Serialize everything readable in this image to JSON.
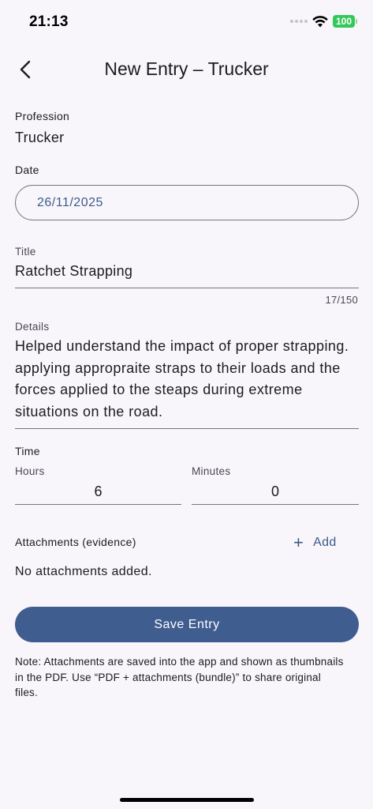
{
  "status_bar": {
    "time": "21:13",
    "battery": "100",
    "icons": [
      "signal-dots-icon",
      "wifi-icon",
      "battery-icon"
    ],
    "battery_color": "#34c759"
  },
  "header": {
    "back_icon": "chevron-left-icon",
    "title": "New Entry – Trucker"
  },
  "profession": {
    "label": "Profession",
    "value": "Trucker"
  },
  "date": {
    "label": "Date",
    "value": "26/11/2025"
  },
  "title_field": {
    "label": "Title",
    "value": "Ratchet Strapping",
    "counter": "17/150"
  },
  "details_field": {
    "label": "Details",
    "value": "Helped understand the impact of proper strapping. applying appropraite straps to their loads and the forces applied to the steaps during extreme situations on the road."
  },
  "time": {
    "label": "Time",
    "hours_label": "Hours",
    "hours_value": "6",
    "minutes_label": "Minutes",
    "minutes_value": "0"
  },
  "attachments": {
    "label": "Attachments (evidence)",
    "add_icon": "plus-icon",
    "add_label": "Add",
    "empty_text": "No attachments added."
  },
  "actions": {
    "save_label": "Save Entry"
  },
  "note": "Note: Attachments are saved into the app and shown as thumbnails in the PDF. Use “PDF + attachments (bundle)” to share original files.",
  "colors": {
    "accent": "#3f5d8f",
    "accent_text": "#3d5a8a",
    "background": "#f8f6fb",
    "outline": "#79747e"
  }
}
